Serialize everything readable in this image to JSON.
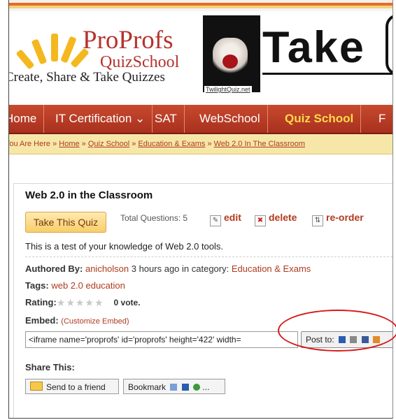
{
  "header": {
    "brand_name": "ProProfs",
    "brand_sub": "QuizSchool",
    "tagline": "Create, Share & Take Quizzes",
    "banner_book_link": "TwilightQuiz.net",
    "banner_text": "Take"
  },
  "nav": {
    "items": [
      {
        "label": "Home"
      },
      {
        "label": "IT Certification ⌄"
      },
      {
        "label": "SAT"
      },
      {
        "label": "WebSchool"
      },
      {
        "label": "Quiz School"
      },
      {
        "label": "F"
      }
    ]
  },
  "breadcrumb": {
    "prefix": "You Are Here » ",
    "home": "Home",
    "sep1": " » ",
    "section": "Quiz School",
    "sep2": " » ",
    "category": "Education & Exams",
    "sep3": " » ",
    "current": "Web 2.0 In The Classroom"
  },
  "quiz": {
    "title": "Web 2.0 in the Classroom",
    "take_label": "Take This Quiz",
    "total_questions": "Total Questions: 5",
    "edit_label": "edit",
    "delete_label": "delete",
    "reorder_label": "re-order",
    "description": "This is a test of your knowledge of Web 2.0 tools.",
    "authored_label": "Authored By:",
    "author": "anicholson",
    "authored_time": " 3 hours ago in category: ",
    "category": "Education & Exams",
    "tags_label": "Tags:",
    "tags": "web 2.0 education",
    "rating_label": "Rating:",
    "stars": "★★★★★",
    "votes": "0 vote.",
    "embed_label": "Embed:",
    "customize_label": "(Customize Embed)",
    "embed_code": "<iframe name='proprofs' id='proprofs' height='422' width=",
    "post_to_label": "Post to:",
    "share_label": "Share This:",
    "send_label": "Send to a friend",
    "bookmark_label": "Bookmark",
    "more_dots": "..."
  },
  "colors": {
    "accent_red": "#b03a1e",
    "nav_bg": "#b83c24",
    "breadcrumb_bg": "#f6e7a8",
    "annotation": "#d61a1a"
  }
}
